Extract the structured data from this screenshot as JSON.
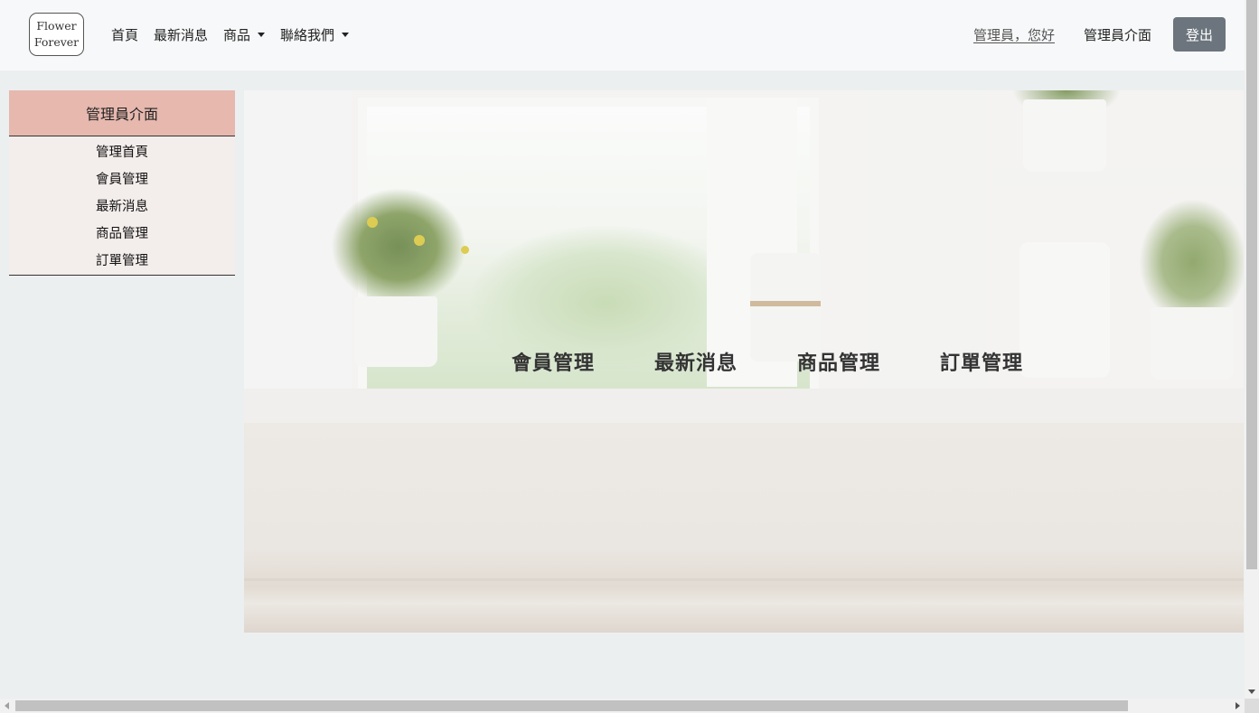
{
  "navbar": {
    "logo_line1": "Flower",
    "logo_line2": "Forever",
    "links": [
      {
        "label": "首頁"
      },
      {
        "label": "最新消息"
      },
      {
        "label": "商品"
      },
      {
        "label": "聯絡我們"
      }
    ],
    "greeting": "管理員，您好",
    "admin_link": "管理員介面",
    "logout_label": "登出"
  },
  "sidebar": {
    "title": "管理員介面",
    "items": [
      {
        "label": "管理首頁"
      },
      {
        "label": "會員管理"
      },
      {
        "label": "最新消息"
      },
      {
        "label": "商品管理"
      },
      {
        "label": "訂單管理"
      }
    ]
  },
  "hero": {
    "links": [
      {
        "label": "會員管理"
      },
      {
        "label": "最新消息"
      },
      {
        "label": "商品管理"
      },
      {
        "label": "訂單管理"
      }
    ]
  },
  "colors": {
    "sidebar_header": "#e6b8ae",
    "sidebar_body": "#f3edeb",
    "logout_button": "#6c757d"
  }
}
